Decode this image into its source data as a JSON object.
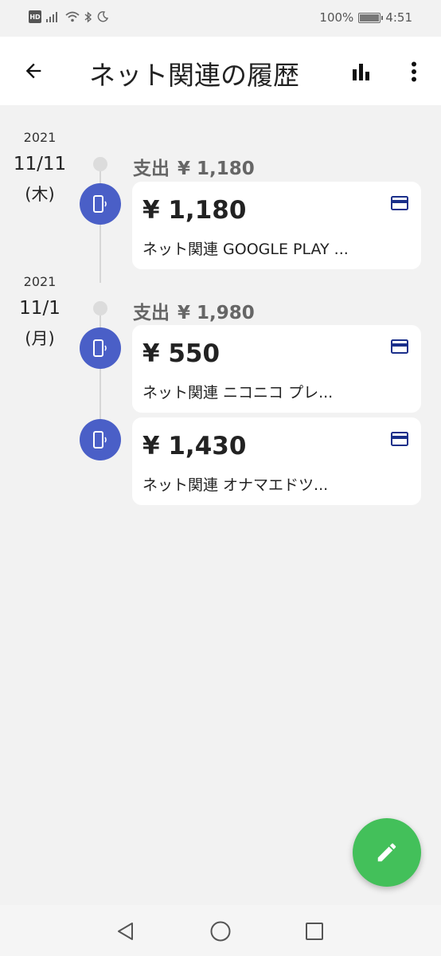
{
  "status_bar": {
    "hd": "HD",
    "battery": "100%",
    "time": "4:51"
  },
  "app_bar": {
    "title": "ネット関連の履歴",
    "back_icon": "arrow-back-icon",
    "chart_icon": "bar-chart-icon",
    "more_icon": "more-vert-icon"
  },
  "groups": [
    {
      "year": "2021",
      "day": "11/11",
      "weekday": "(木)",
      "header_label": "支出",
      "header_amount": "¥ 1,180",
      "items": [
        {
          "amount": "¥ 1,180",
          "description": "ネット関連 GOOGLE PLAY ...",
          "icon": "phone-icon",
          "type_icon": "credit-card-icon"
        }
      ]
    },
    {
      "year": "2021",
      "day": "11/1",
      "weekday": "(月)",
      "header_label": "支出",
      "header_amount": "¥ 1,980",
      "items": [
        {
          "amount": "¥ 550",
          "description": "ネット関連 ニコニコ プレ...",
          "icon": "phone-icon",
          "type_icon": "credit-card-icon"
        },
        {
          "amount": "¥ 1,430",
          "description": "ネット関連 オナマエドツ...",
          "icon": "phone-icon",
          "type_icon": "credit-card-icon"
        }
      ]
    }
  ],
  "fab": {
    "icon": "edit-pencil-icon"
  },
  "colors": {
    "accent_blue": "#4a5fc7",
    "fab_green": "#43c05a",
    "card_icon": "#1a2f8a"
  }
}
